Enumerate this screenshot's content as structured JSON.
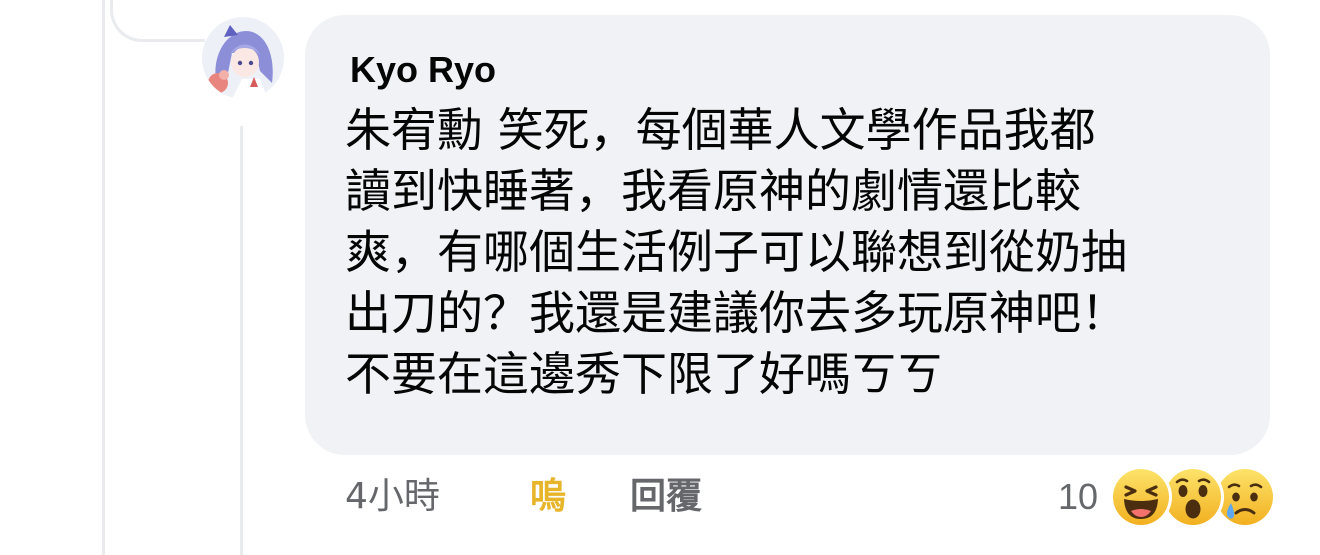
{
  "comment": {
    "author": "Kyo Ryo",
    "text_lines": [
      "朱宥勳 笑死，每個華人文學作品我都",
      "讀到快睡著，我看原神的劇情還比較",
      "爽，有哪個生活例子可以聯想到從奶抽",
      "出刀的？我還是建議你去多玩原神吧！",
      "不要在這邊秀下限了好嗎ㄎㄎ"
    ],
    "timestamp": "4小時",
    "like_label": "嗚",
    "reply_label": "回覆",
    "reaction_count": "10",
    "reactions": [
      "haha-reaction-icon",
      "wow-reaction-icon",
      "sad-reaction-icon"
    ]
  },
  "colors": {
    "bubble_bg": "#f0f2f5",
    "text": "#050505",
    "meta": "#65676b",
    "like_active": "#e7b529",
    "thread_line": "#e9ebef"
  }
}
